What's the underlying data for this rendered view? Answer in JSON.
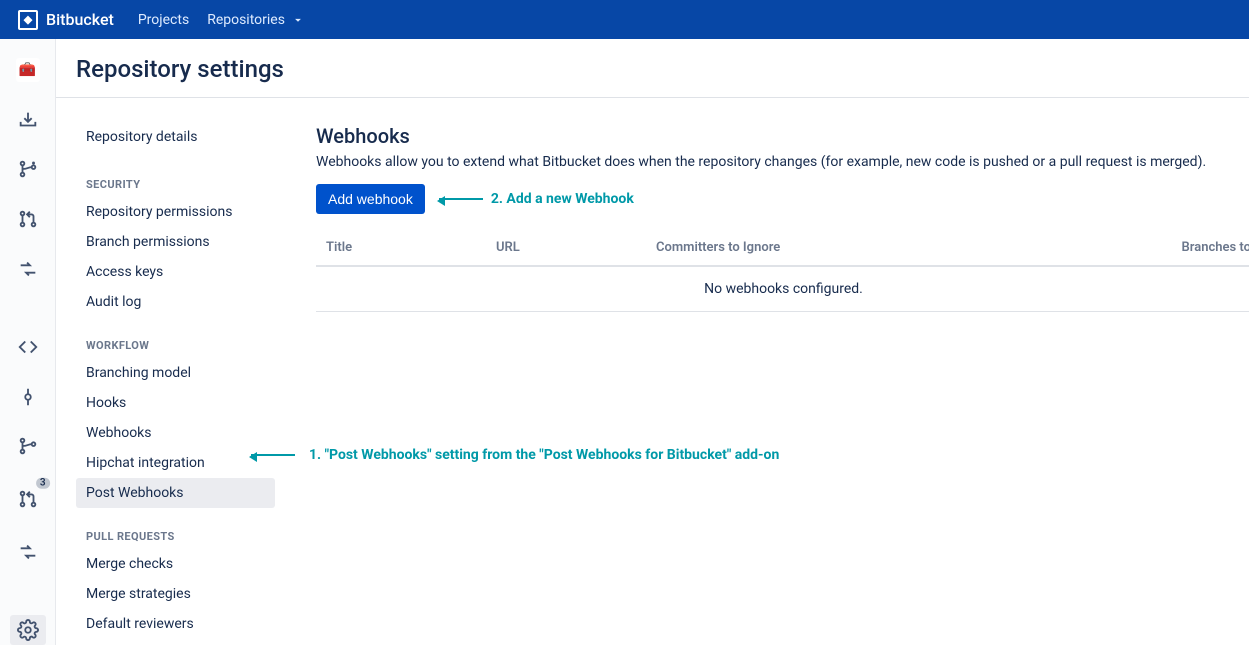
{
  "header": {
    "brand": "Bitbucket",
    "nav": {
      "projects": "Projects",
      "repositories": "Repositories"
    }
  },
  "page_title": "Repository settings",
  "icon_rail": {
    "pr_badge": "3"
  },
  "sidebar": {
    "items": [
      {
        "label": "Repository details"
      }
    ],
    "security_label": "SECURITY",
    "security": [
      {
        "label": "Repository permissions"
      },
      {
        "label": "Branch permissions"
      },
      {
        "label": "Access keys"
      },
      {
        "label": "Audit log"
      }
    ],
    "workflow_label": "WORKFLOW",
    "workflow": [
      {
        "label": "Branching model"
      },
      {
        "label": "Hooks"
      },
      {
        "label": "Webhooks"
      },
      {
        "label": "Hipchat integration"
      },
      {
        "label": "Post Webhooks"
      }
    ],
    "pull_label": "PULL REQUESTS",
    "pull": [
      {
        "label": "Merge checks"
      },
      {
        "label": "Merge strategies"
      },
      {
        "label": "Default reviewers"
      }
    ]
  },
  "panel": {
    "title": "Webhooks",
    "description": "Webhooks allow you to extend what Bitbucket does when the repository changes (for example, new code is pushed or a pull request is merged).",
    "add_button": "Add webhook",
    "columns": {
      "title": "Title",
      "url": "URL",
      "committers": "Committers to Ignore",
      "branches": "Branches to"
    },
    "empty": "No webhooks configured."
  },
  "annotations": {
    "one": "1. \"Post Webhooks\" setting from the \"Post Webhooks for Bitbucket\" add-on",
    "two": "2. Add a new Webhook"
  },
  "colors": {
    "nav_bg": "#0747A6",
    "primary_btn": "#0052CC",
    "annotation": "#0099A8"
  }
}
